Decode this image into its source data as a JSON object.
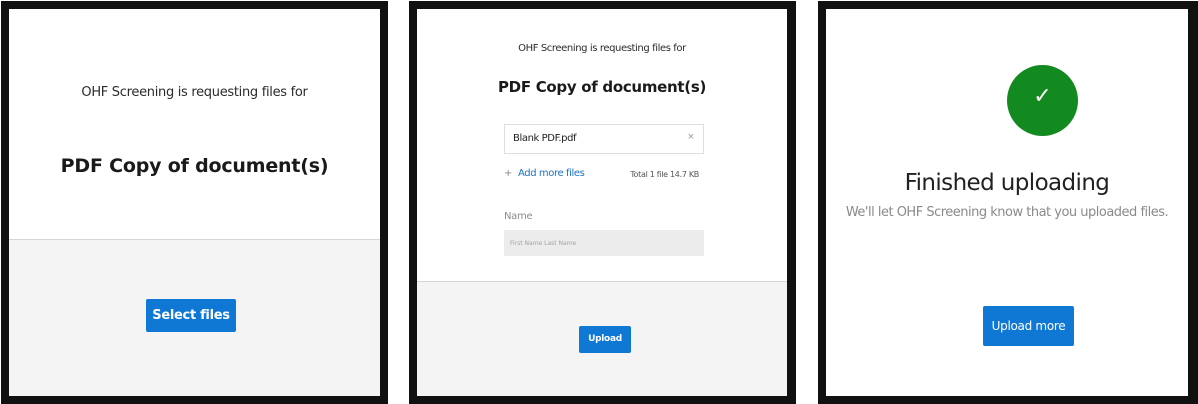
{
  "panel_select": {
    "requesting_text": "OHF Screening is requesting files for",
    "title": "PDF Copy of document(s)",
    "select_button": "Select files"
  },
  "panel_upload": {
    "requesting_text": "OHF Screening is requesting files for",
    "title": "PDF Copy of document(s)",
    "file_name": "Blank PDF.pdf",
    "remove_icon": "×",
    "add_more_label": "Add more files",
    "add_more_icon": "+",
    "total_text": "Total 1 file 14.7 KB",
    "name_label": "Name",
    "name_placeholder": "First Name Last Name",
    "upload_button": "Upload"
  },
  "panel_finished": {
    "check_icon": "✓",
    "heading": "Finished uploading",
    "subtitle": "We'll let OHF Screening know that you uploaded files.",
    "upload_more_button": "Upload more",
    "accent_color": "#138a1f"
  },
  "theme": {
    "button_color": "#0f78d4",
    "link_color": "#1a73c8"
  }
}
